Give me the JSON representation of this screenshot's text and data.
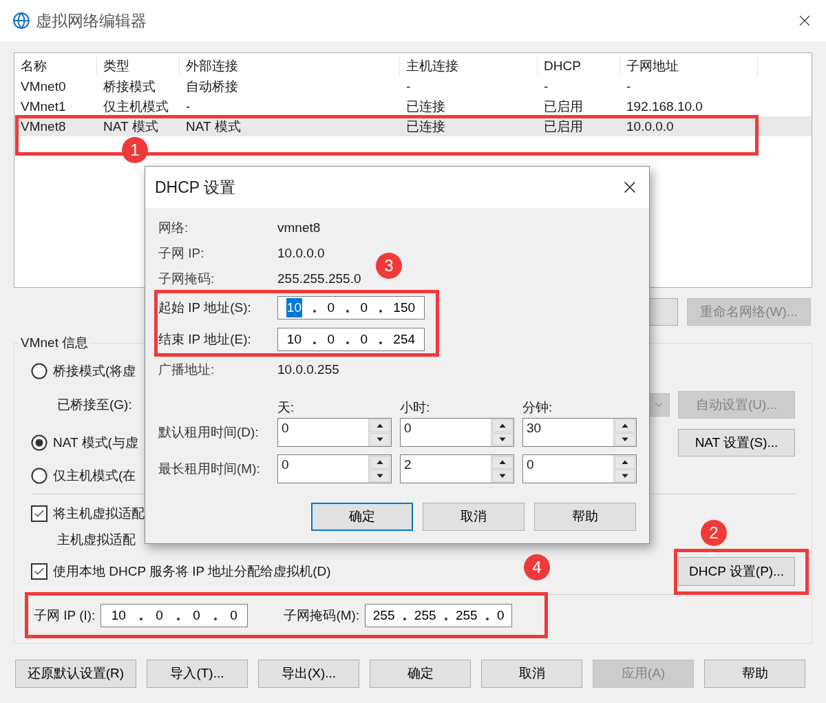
{
  "window": {
    "title": "虚拟网络编辑器"
  },
  "table": {
    "columns": [
      "名称",
      "类型",
      "外部连接",
      "主机连接",
      "DHCP",
      "子网地址"
    ],
    "rows": [
      {
        "cells": [
          "VMnet0",
          "桥接模式",
          "自动桥接",
          "-",
          "-",
          "-"
        ],
        "selected": false
      },
      {
        "cells": [
          "VMnet1",
          "仅主机模式",
          "-",
          "已连接",
          "已启用",
          "192.168.10.0"
        ],
        "selected": false
      },
      {
        "cells": [
          "VMnet8",
          "NAT 模式",
          "NAT 模式",
          "已连接",
          "已启用",
          "10.0.0.0"
        ],
        "selected": true
      }
    ]
  },
  "top_buttons": [
    {
      "label": "重命名网络(W)...",
      "disabled": true
    }
  ],
  "vmnet_info": {
    "title": "VMnet 信息",
    "modes": [
      {
        "label": "桥接模式(将虚",
        "selected": false
      },
      {
        "label": "NAT 模式(与虚",
        "selected": true
      },
      {
        "label": "仅主机模式(在",
        "selected": false
      }
    ],
    "bridged_to_label": "已桥接至(G):",
    "auto_button": {
      "label": "自动设置(U)...",
      "disabled": true
    },
    "nat_button": {
      "label": "NAT 设置(S)...",
      "disabled": false
    },
    "host_adapter": {
      "label": "将主机虚拟适配",
      "checked": true
    },
    "adapter_name": "主机虚拟适配",
    "dhcp": {
      "label": "使用本地 DHCP 服务将 IP 地址分配给虚拟机(D)",
      "checked": true
    },
    "dhcp_button": {
      "label": "DHCP 设置(P)...",
      "disabled": false
    },
    "subnet_ip": {
      "label": "子网 IP (I):",
      "octets": [
        "10",
        "0",
        "0",
        "0"
      ]
    },
    "subnet_mask": {
      "label": "子网掩码(M):",
      "octets": [
        "255",
        "255",
        "255",
        "0"
      ]
    }
  },
  "bottom_buttons": [
    {
      "label": "还原默认设置(R)",
      "disabled": false
    },
    {
      "label": "导入(T)...",
      "disabled": false
    },
    {
      "label": "导出(X)...",
      "disabled": false
    },
    {
      "label": "确定",
      "disabled": false
    },
    {
      "label": "取消",
      "disabled": false
    },
    {
      "label": "应用(A)",
      "disabled": true
    },
    {
      "label": "帮助",
      "disabled": false
    }
  ],
  "dhcp_dialog": {
    "title": "DHCP 设置",
    "info": [
      {
        "label": "网络:",
        "value": "vmnet8"
      },
      {
        "label": "子网 IP:",
        "value": "10.0.0.0"
      },
      {
        "label": "子网掩码:",
        "value": "255.255.255.0"
      }
    ],
    "start_ip": {
      "label": "起始 IP 地址(S):",
      "octets": [
        {
          "value": "10",
          "selected": true
        },
        {
          "value": "0",
          "selected": false
        },
        {
          "value": "0",
          "selected": false
        },
        {
          "value": "150",
          "selected": false
        }
      ]
    },
    "end_ip": {
      "label": "结束 IP 地址(E):",
      "octets": [
        {
          "value": "10",
          "selected": false
        },
        {
          "value": "0",
          "selected": false
        },
        {
          "value": "0",
          "selected": false
        },
        {
          "value": "254",
          "selected": false
        }
      ]
    },
    "broadcast": {
      "label": "广播地址:",
      "value": "10.0.0.255"
    },
    "lease_columns": [
      "天:",
      "小时:",
      "分钟:"
    ],
    "leases": [
      {
        "label": "默认租用时间(D):",
        "values": [
          "0",
          "0",
          "30"
        ]
      },
      {
        "label": "最长租用时间(M):",
        "values": [
          "0",
          "2",
          "0"
        ]
      }
    ],
    "buttons": [
      {
        "label": "确定",
        "default": true
      },
      {
        "label": "取消",
        "default": false
      },
      {
        "label": "帮助",
        "default": false
      }
    ]
  },
  "annotations": [
    {
      "number": "1"
    },
    {
      "number": "2"
    },
    {
      "number": "3"
    },
    {
      "number": "4"
    }
  ]
}
